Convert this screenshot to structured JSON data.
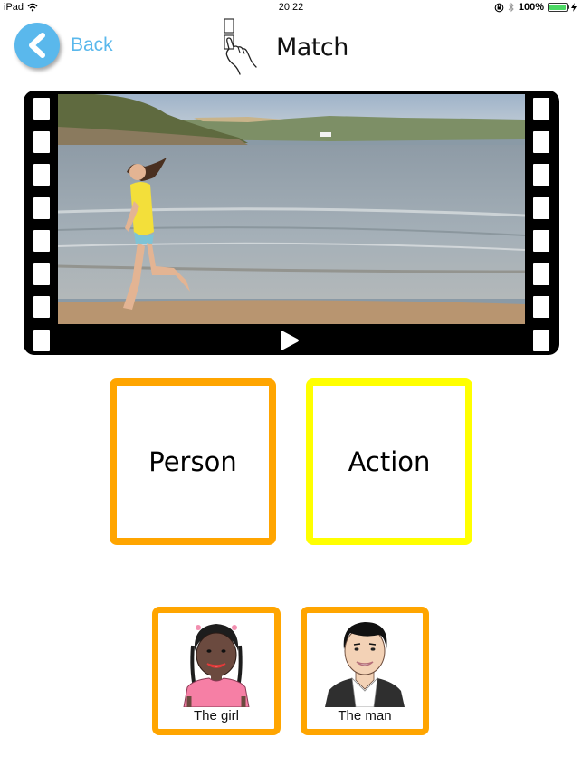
{
  "status_bar": {
    "device": "iPad",
    "time": "20:22",
    "battery": "100%",
    "icons": [
      "wifi-icon",
      "rotation-lock-icon",
      "bluetooth-icon",
      "battery-icon",
      "charging-icon"
    ]
  },
  "header": {
    "back_label": "Back",
    "title": "Match",
    "title_icon": "hand-tap-match-icon"
  },
  "video": {
    "description": "Girl running along a beach",
    "play_icon": "play-icon"
  },
  "categories": [
    {
      "label": "Person",
      "color": "#ffa500"
    },
    {
      "label": "Action",
      "color": "#ffff00"
    }
  ],
  "answers": [
    {
      "label": "The girl",
      "color": "#ffa500"
    },
    {
      "label": "The man",
      "color": "#ffa500"
    }
  ],
  "colors": {
    "accent_blue": "#5ab8ec",
    "orange": "#ffa500",
    "yellow": "#ffff00",
    "battery_green": "#4cd964"
  }
}
